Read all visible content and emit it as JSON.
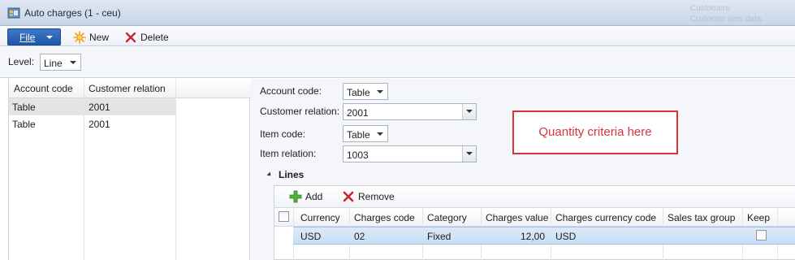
{
  "window": {
    "title": "Auto charges (1 - ceu)",
    "ghost_text": [
      "Customers",
      "Customer item data"
    ]
  },
  "toolbar": {
    "file_label": "File",
    "new_label": "New",
    "delete_label": "Delete"
  },
  "level": {
    "label": "Level:",
    "value": "Line"
  },
  "left_grid": {
    "columns": [
      "Account code",
      "Customer relation"
    ],
    "rows": [
      {
        "account_code": "Table",
        "customer_relation": "2001"
      },
      {
        "account_code": "Table",
        "customer_relation": "2001"
      }
    ]
  },
  "form": {
    "account_code": {
      "label": "Account code:",
      "value": "Table"
    },
    "customer_relation": {
      "label": "Customer relation:",
      "value": "2001"
    },
    "item_code": {
      "label": "Item code:",
      "value": "Table"
    },
    "item_relation": {
      "label": "Item relation:",
      "value": "1003"
    }
  },
  "callout": {
    "text": "Quantity criteria here",
    "color": "#d9343a"
  },
  "lines": {
    "section_title": "Lines",
    "add_label": "Add",
    "remove_label": "Remove",
    "columns": [
      "Currency",
      "Charges code",
      "Category",
      "Charges value",
      "Charges currency code",
      "Sales tax group",
      "Keep"
    ],
    "rows": [
      {
        "currency": "USD",
        "charges_code": "02",
        "category": "Fixed",
        "charges_value": "12,00",
        "charges_currency_code": "USD",
        "sales_tax_group": "",
        "keep": false
      }
    ]
  },
  "colors": {
    "file_button": "#2a63b6",
    "selected_row": "#cfe3f7",
    "accent_red": "#d9343a"
  }
}
